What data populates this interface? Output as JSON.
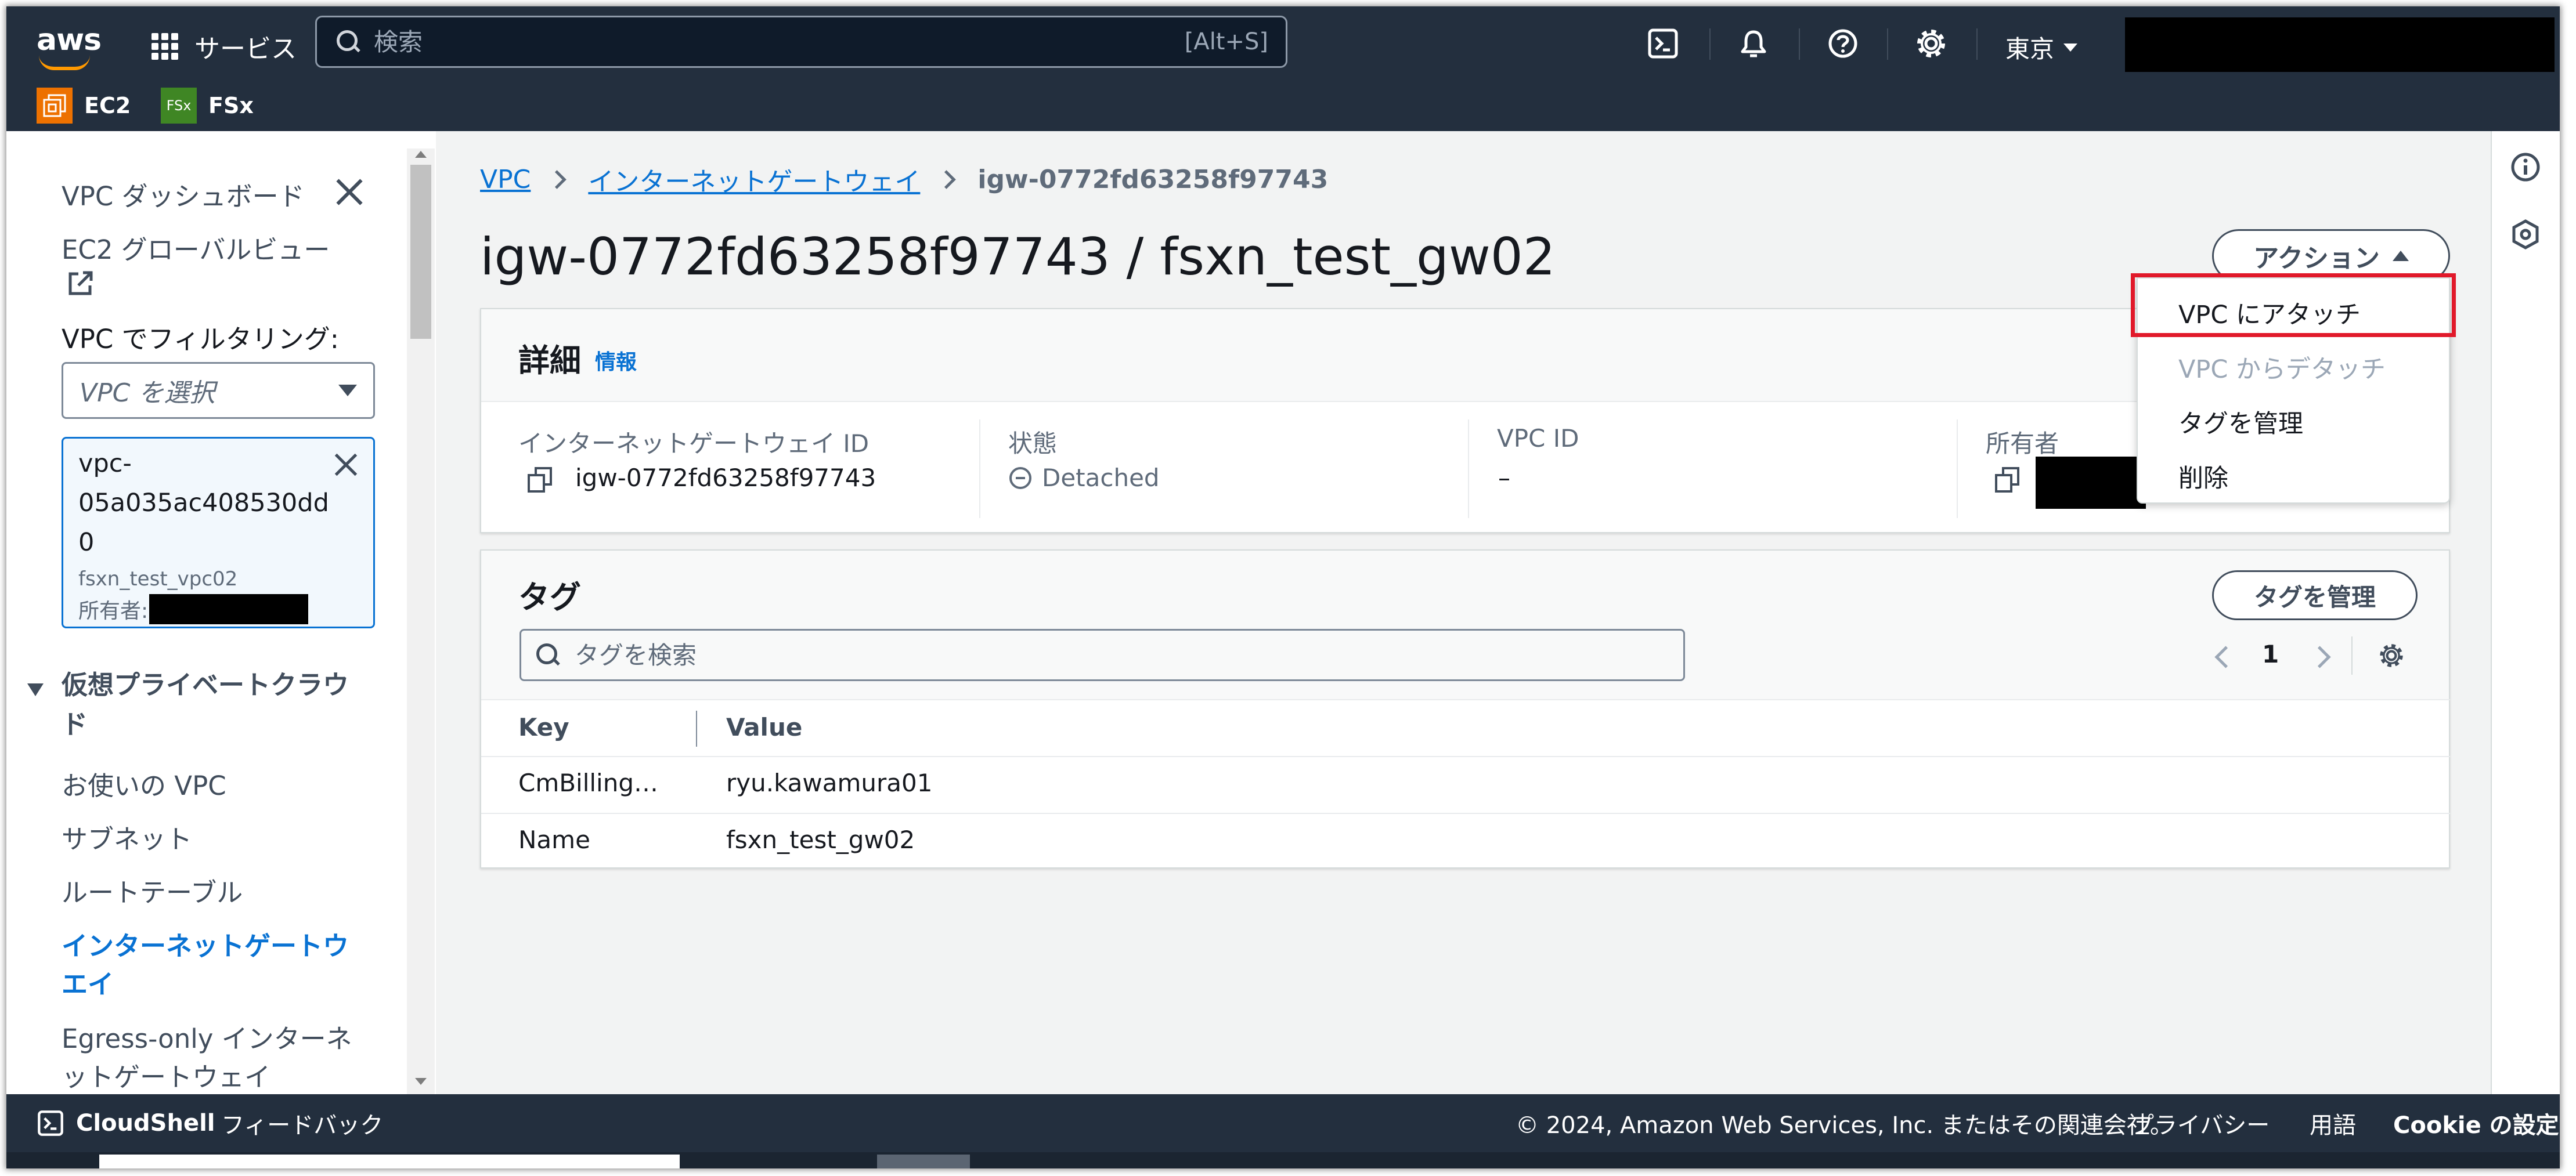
{
  "topnav": {
    "logo_text": "aws",
    "services_label": "サービス",
    "search_placeholder": "検索",
    "search_shortcut": "[Alt+S]",
    "region": "東京",
    "icons": [
      "cloudshell-icon",
      "bell-icon",
      "help-icon",
      "gear-icon"
    ]
  },
  "favorites": [
    {
      "label": "EC2",
      "icon": "ec2-icon",
      "color": "#ed7100"
    },
    {
      "label": "FSx",
      "icon": "fsx-icon",
      "color": "#3f8624",
      "icon_text": "FSx"
    }
  ],
  "sidebar": {
    "dashboard": "VPC ダッシュボード",
    "ec2_global_view": "EC2 グローバルビュー",
    "filter_label": "VPC でフィルタリング:",
    "filter_placeholder": "VPC を選択",
    "selected_vpc": {
      "id_line1": "vpc-",
      "id_line2": "05a035ac408530dd",
      "id_line3": "0",
      "name": "fsxn_test_vpc02",
      "owner_label": "所有者:"
    },
    "section_line1": "仮想プライベートクラウ",
    "section_line2": "ド",
    "items": [
      {
        "label": "お使いの VPC"
      },
      {
        "label": "サブネット"
      },
      {
        "label": "ルートテーブル"
      },
      {
        "label_line1": "インターネットゲートウ",
        "label_line2": "エイ",
        "active": true
      },
      {
        "label_line1": "Egress-only インターネ",
        "label_line2": "ットゲートウェイ"
      }
    ]
  },
  "breadcrumb": {
    "root": "VPC",
    "parent": "インターネットゲートウェイ",
    "current": "igw-0772fd63258f97743"
  },
  "page_title": "igw-0772fd63258f97743 / fsxn_test_gw02",
  "actions": {
    "label": "アクション",
    "menu": [
      {
        "label": "VPC にアタッチ",
        "highlighted": true,
        "disabled": false
      },
      {
        "label": "VPC からデタッチ",
        "disabled": true
      },
      {
        "label": "タグを管理",
        "disabled": false
      },
      {
        "label": "削除",
        "disabled": false
      }
    ]
  },
  "details": {
    "title": "詳細",
    "info_link": "情報",
    "fields": {
      "igw_id_label": "インターネットゲートウェイ ID",
      "igw_id_value": "igw-0772fd63258f97743",
      "state_label": "状態",
      "state_value": "Detached",
      "vpc_id_label": "VPC ID",
      "vpc_id_value": "–",
      "owner_label": "所有者"
    }
  },
  "tags": {
    "title": "タグ",
    "manage_button": "タグを管理",
    "search_placeholder": "タグを検索",
    "page": "1",
    "columns": [
      "Key",
      "Value"
    ],
    "rows": [
      {
        "key": "CmBilling…",
        "value": "ryu.kawamura01"
      },
      {
        "key": "Name",
        "value": "fsxn_test_gw02"
      }
    ]
  },
  "footer": {
    "cloudshell": "CloudShell",
    "feedback": "フィードバック",
    "copyright": "© 2024, Amazon Web Services, Inc. またはその関連会社。",
    "privacy": "プライバシー",
    "terms": "用語",
    "cookies": "Cookie の設定"
  },
  "colors": {
    "nav_bg": "#232f3e",
    "link": "#0972d3",
    "highlight_box": "#e1192a"
  }
}
